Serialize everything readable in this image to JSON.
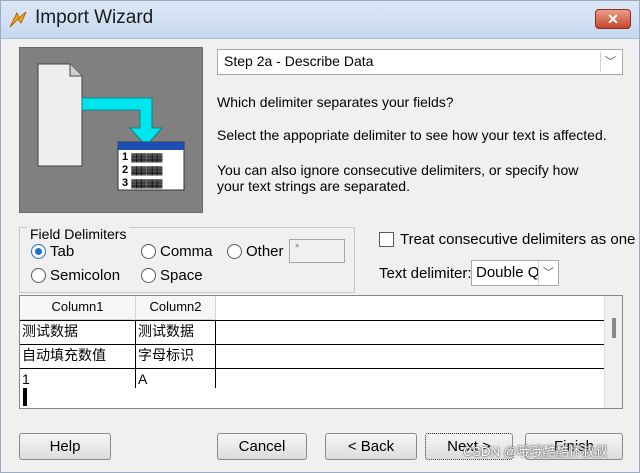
{
  "window": {
    "title": "Import Wizard",
    "close_label": "✕"
  },
  "step": {
    "selected": "Step 2a - Describe Data"
  },
  "instructions": [
    "Which delimiter separates your fields?",
    "Select the appopriate delimiter to see how your text is affected.",
    "You can also ignore consecutive delimiters, or specify how",
    "your text strings are separated."
  ],
  "illustration": {
    "rows": [
      "1",
      "2",
      "3"
    ],
    "cells": "▓▓▓ ▓▓▓"
  },
  "field_delimiters": {
    "legend": "Field Delimiters",
    "tab": "Tab",
    "comma": "Comma",
    "other": "Other",
    "semicolon": "Semicolon",
    "space": "Space",
    "selected": "Tab",
    "other_value": "*"
  },
  "treat_consecutive": {
    "label": "Treat consecutive delimiters as one",
    "checked": false
  },
  "text_delimiter": {
    "label": "Text delimiter:",
    "value": "Double Q"
  },
  "preview": {
    "headers": [
      "Column1",
      "Column2"
    ],
    "rows": [
      [
        "测试数据",
        "测试数据"
      ],
      [
        "自动填充数值",
        "字母标识"
      ],
      [
        "1",
        "A"
      ]
    ]
  },
  "buttons": {
    "help": "Help",
    "cancel": "Cancel",
    "back": "< Back",
    "next": "Next >",
    "finish": "Finish"
  },
  "watermark": "CSDN @哦哦酷酷怀叔叔",
  "colors": {
    "accent": "#1f6fd0",
    "arrow": "#00e5ee",
    "close": "#c6462b"
  }
}
